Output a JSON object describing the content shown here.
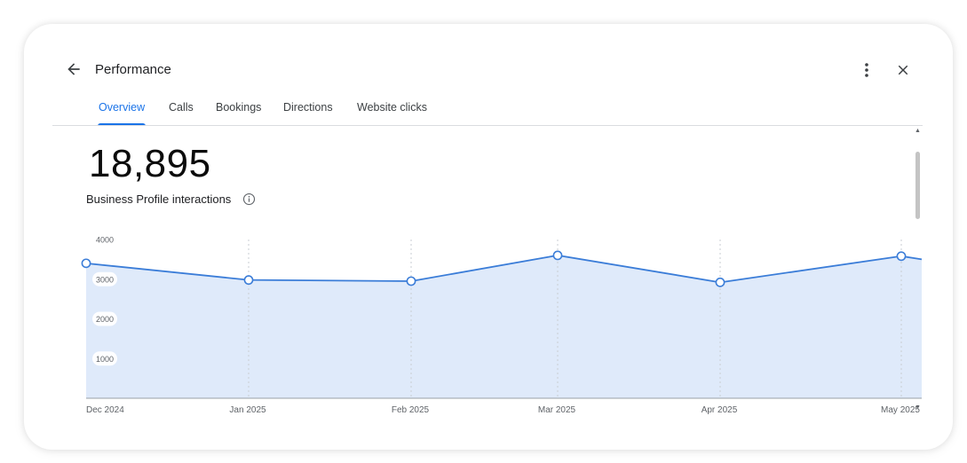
{
  "header": {
    "title": "Performance",
    "icons": {
      "back": "arrow-back-icon",
      "more": "more-vert-icon",
      "close": "close-icon"
    }
  },
  "tabs": [
    {
      "label": "Overview",
      "active": true
    },
    {
      "label": "Calls",
      "active": false
    },
    {
      "label": "Bookings",
      "active": false
    },
    {
      "label": "Directions",
      "active": false
    },
    {
      "label": "Website clicks",
      "active": false
    }
  ],
  "metric": {
    "value": "18,895",
    "label": "Business Profile interactions",
    "info_icon": "info-icon"
  },
  "colors": {
    "accent": "#1a73e8",
    "area_fill": "#dfeafa",
    "line": "#3b7dd8"
  },
  "chart_data": {
    "type": "area",
    "x": [
      "Dec 2024",
      "Jan 2025",
      "Feb 2025",
      "Mar 2025",
      "Apr 2025",
      "May 2025"
    ],
    "y_ticks": [
      4000,
      3000,
      2000,
      1000
    ],
    "ylim": [
      0,
      4000
    ],
    "values": [
      3400,
      2980,
      2950,
      3600,
      2920,
      3580
    ],
    "trailing_value": 3500,
    "xlabel": "",
    "ylabel": "",
    "grid": true
  }
}
